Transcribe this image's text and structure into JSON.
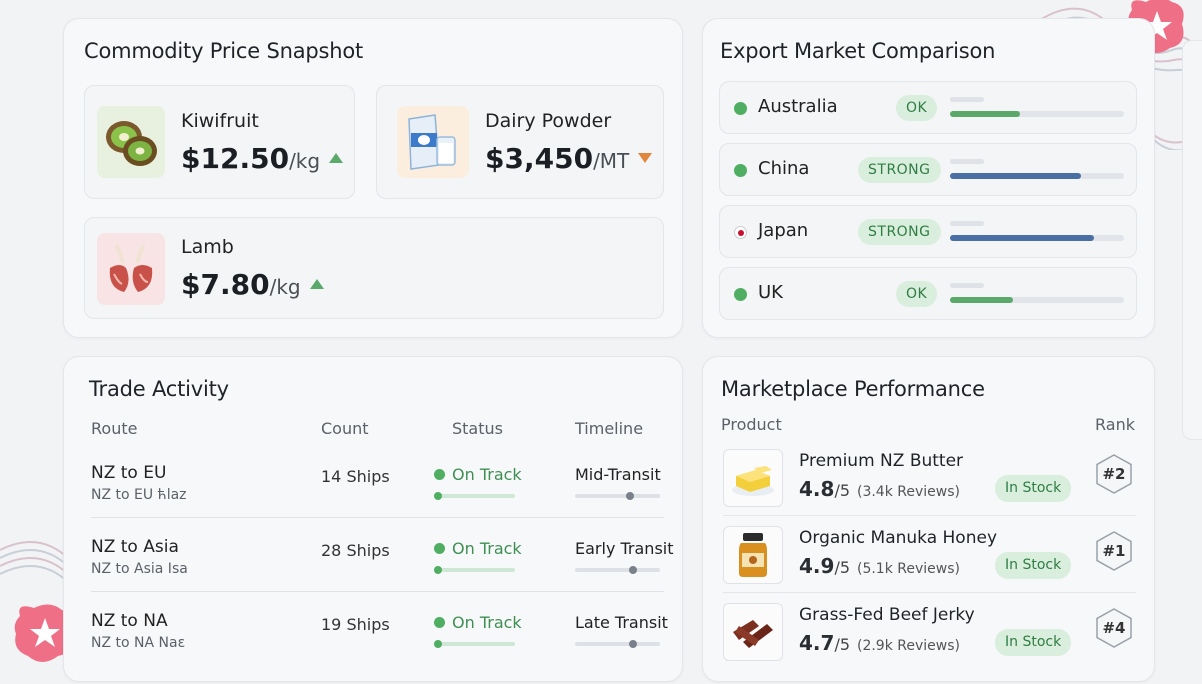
{
  "commodity": {
    "title": "Commodity Price Snapshot",
    "items": [
      {
        "name": "Kiwifruit",
        "price": "$12.50",
        "unit": "/kg",
        "trend": "up",
        "icon": "kiwifruit-icon"
      },
      {
        "name": "Dairy Powder",
        "price": "$3,450",
        "unit": "/MT",
        "trend": "down",
        "icon": "dairy-powder-icon"
      },
      {
        "name": "Lamb",
        "price": "$7.80",
        "unit": "/kg",
        "trend": "up",
        "icon": "lamb-icon"
      }
    ]
  },
  "export": {
    "title": "Export Market Comparison",
    "markets": [
      {
        "country": "Australia",
        "status": "OK",
        "dot_color": "#4fae62",
        "bar_color": "#5aa86a",
        "level": 0.4
      },
      {
        "country": "China",
        "status": "STRONG",
        "dot_color": "#4fae62",
        "bar_color": "#4a6fa5",
        "level": 0.75
      },
      {
        "country": "Japan",
        "status": "STRONG",
        "dot_color": "#c8102e",
        "bar_color": "#4a6fa5",
        "level": 0.83
      },
      {
        "country": "UK",
        "status": "OK",
        "dot_color": "#4fae62",
        "bar_color": "#5aa86a",
        "level": 0.36
      }
    ]
  },
  "trade": {
    "title": "Trade Activity",
    "headers": {
      "route": "Route",
      "count": "Count",
      "status": "Status",
      "timeline": "Timeline"
    },
    "rows": [
      {
        "route": "NZ to EU",
        "sub": "NZ to EU ћlaz",
        "count": "14 Ships",
        "status": "On Track",
        "timeline": "Mid-Transit",
        "progress": 0.65
      },
      {
        "route": "NZ to Asia",
        "sub": "NZ to Asia Isa",
        "count": "28 Ships",
        "status": "On Track",
        "timeline": "Early Transit",
        "progress": 0.68
      },
      {
        "route": "NZ to NA",
        "sub": "NZ to NA Naɛ",
        "count": "19 Ships",
        "status": "On Track",
        "timeline": "Late Transit",
        "progress": 0.68
      }
    ]
  },
  "marketplace": {
    "title": "Marketplace Performance",
    "headers": {
      "product": "Product",
      "rank": "Rank"
    },
    "products": [
      {
        "name": "Premium NZ Butter",
        "rating": "4.8",
        "out_of": "/5",
        "reviews": "(3.4k Reviews)",
        "stock": "In Stock",
        "rank": "#2",
        "icon": "butter-icon"
      },
      {
        "name": "Organic Manuka Honey",
        "rating": "4.9",
        "out_of": "/5",
        "reviews": "(5.1k Reviews)",
        "stock": "In Stock",
        "rank": "#1",
        "icon": "honey-jar-icon"
      },
      {
        "name": "Grass-Fed Beef Jerky",
        "rating": "4.7",
        "out_of": "/5",
        "reviews": "(2.9k Reviews)",
        "stock": "In Stock",
        "rank": "#4",
        "icon": "beef-jerky-icon"
      }
    ]
  },
  "colors": {
    "accent_green": "#4fae62",
    "accent_blue": "#4a6fa5",
    "accent_orange": "#e0873c",
    "decor_pink": "#ef6f86"
  }
}
